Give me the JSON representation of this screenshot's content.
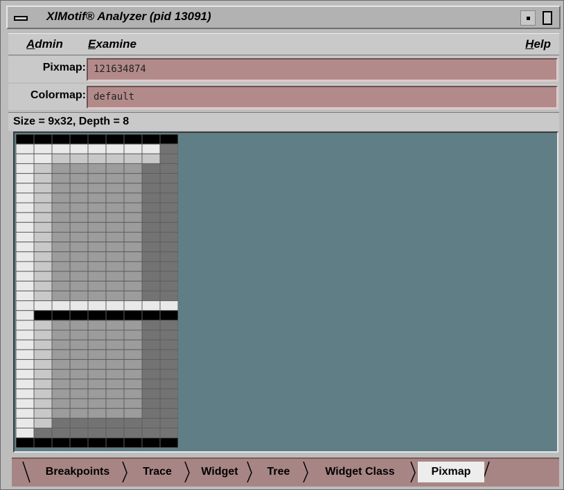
{
  "window": {
    "title": "XlMotif® Analyzer (pid 13091)",
    "menu_icon": "window-menu-icon",
    "minimize_icon": "minimize-icon",
    "maximize_icon": "maximize-icon"
  },
  "menubar": {
    "items": [
      {
        "label": "Admin",
        "mnemonic": "A"
      },
      {
        "label": "Examine",
        "mnemonic": "E"
      },
      {
        "label": "Help",
        "mnemonic": "H"
      }
    ]
  },
  "fields": {
    "pixmap": {
      "label": "Pixmap:",
      "value": "121634874"
    },
    "colormap": {
      "label": "Colormap:",
      "value": "default"
    }
  },
  "status": {
    "text": "Size = 9x32, Depth = 8"
  },
  "pixmap_view": {
    "columns": 9,
    "rows": 32,
    "palette": {
      "0": "#000000",
      "1": "#e9e9e9",
      "2": "#c8c8c8",
      "3": "#9c9c9c",
      "4": "#737373"
    },
    "pixels": [
      "000000000",
      "111111114",
      "112222224",
      "123333344",
      "123333344",
      "123333344",
      "123333344",
      "123333344",
      "123333344",
      "123333344",
      "123333344",
      "123333344",
      "123333344",
      "123333344",
      "123333344",
      "123333344",
      "123333344",
      "111111111",
      "100000000",
      "123333344",
      "123333344",
      "123333344",
      "123333344",
      "123333344",
      "123333344",
      "123333344",
      "123333344",
      "123333344",
      "123333344",
      "124444444",
      "144444444",
      "000000000"
    ]
  },
  "tabs": [
    {
      "label": "Breakpoints",
      "active": false
    },
    {
      "label": "Trace",
      "active": false
    },
    {
      "label": "Widget",
      "active": false
    },
    {
      "label": "Tree",
      "active": false
    },
    {
      "label": "Widget Class",
      "active": false
    },
    {
      "label": "Pixmap",
      "active": true
    }
  ],
  "colors": {
    "field_bg": "#b38a8a",
    "canvas_bg": "#5f7e86",
    "tabbar_bg": "#a88585",
    "chrome": "#c9c9c9"
  }
}
